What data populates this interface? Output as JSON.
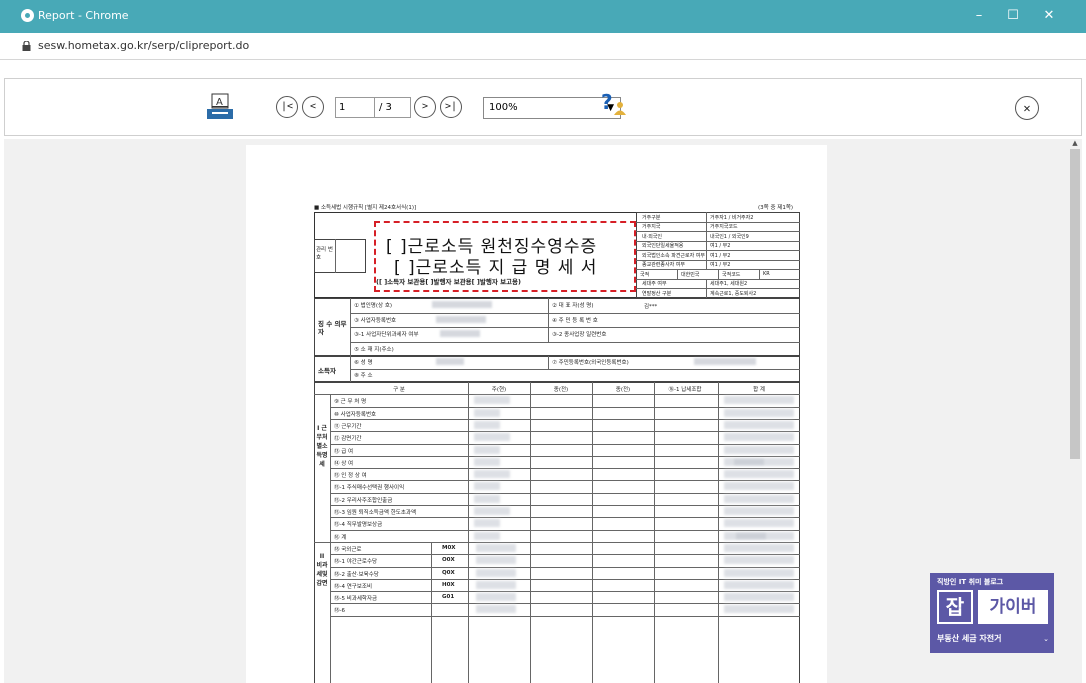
{
  "window": {
    "title": "Report - Chrome",
    "url": "sesw.hometax.go.kr/serp/clipreport.do",
    "minimize": "–",
    "maximize": "☐",
    "close": "✕"
  },
  "toolbar": {
    "first": "|<",
    "prev": "<",
    "page": "1",
    "total": "/ 3",
    "next": ">",
    "last": ">|",
    "zoom": "100%",
    "help": "?",
    "close": "✕"
  },
  "form": {
    "rule": "■ 소득세법 시행규칙 [별지 제24호서식(1)]",
    "pages": "(3쪽 중 제1쪽)",
    "mgmt_no": "관리 번호",
    "title1": "[ ]근로소득 원천징수영수증",
    "title2": "[ ]근로소득 지 급 명 세 서",
    "subtitle": "([   ]소득자 보관용[    ]발행자 보관용[    ]발행자 보고용)",
    "right_rows": [
      [
        "거주구분",
        "거주자1 / 비거주자2"
      ],
      [
        "거주지국",
        "거주지국코드"
      ],
      [
        "내·외국인",
        "내국인1 / 외국인9"
      ],
      [
        "외국인단일세율적용",
        "여1 / 부2"
      ],
      [
        "외국법인소속 파견근로자 여부",
        "여1 / 부2"
      ],
      [
        "종교관련종사자 여부",
        "여1 / 부2"
      ],
      [
        "국적",
        "대한민국",
        "국적코드",
        "KR"
      ],
      [
        "세대주 여부",
        "세대주1, 세대원2"
      ],
      [
        "연말정산 구분",
        "계속근로1, 중도퇴사2"
      ]
    ],
    "payer_label": "징 수 의무자",
    "payer_rows": [
      "① 법인명(상 호)",
      "③ 사업자등록번호",
      "③-1 사업자단위과세자 여부",
      "⑤ 소 재 지(주소)"
    ],
    "payer_right": [
      "② 대 표 자(성 명)",
      "④ 주 민 등 록 번 호",
      "③-2 종사업장 일련번호"
    ],
    "rep_name": "김***",
    "earner_label": "소득자",
    "earner_rows": [
      "⑥ 성      명",
      "⑧ 주      소"
    ],
    "earner_right": "⑦ 주민등록번호(외국인등록번호)",
    "col_headers": [
      "구  분",
      "주(현)",
      "종(전)",
      "종(전)",
      "⑯-1 납세조합",
      "합  계"
    ],
    "section1_label": "I 근무처별소득명세",
    "section1_rows": [
      "⑨ 근 무 처 명",
      "⑩ 사업자등록번호",
      "⑪ 근무기간",
      "⑫ 감면기간",
      "⑬ 급        여",
      "⑭ 상        여",
      "⑮ 인 정 상 여",
      "⑮-1 주식매수선택권 행사이익",
      "⑮-2 우리사주조합인출금",
      "⑮-3 임원 퇴직소득금액 한도초과액",
      "⑮-4 직무발명보상금",
      "⑯ 계"
    ],
    "section2_label": "II 비과세및감면",
    "section2_rows": [
      [
        "⑱ 국외근로",
        "M0X"
      ],
      [
        "⑱-1 야간근로수당",
        "O0X"
      ],
      [
        "⑱-2 출산·보육수당",
        "Q0X"
      ],
      [
        "⑱-4 연구보조비",
        "H0X"
      ],
      [
        "⑱-5 비과세학자금",
        "G01"
      ],
      [
        "⑱-6",
        ""
      ]
    ]
  },
  "badge": {
    "top": "직방인 IT 취미 블로그",
    "logo": "잡",
    "name": "가이버",
    "bottom": "부동산 세금 자전거",
    "arrow": "⌄"
  }
}
